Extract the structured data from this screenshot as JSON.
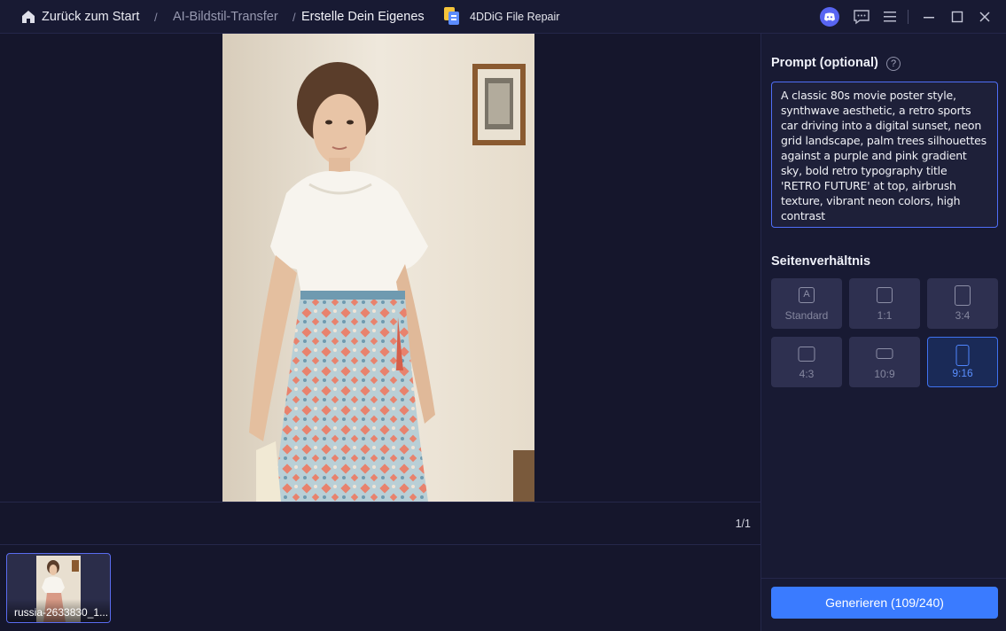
{
  "header": {
    "breadcrumb_home": "Zurück zum Start",
    "separator": "/",
    "breadcrumb_mid": "AI-Bildstil-Transfer",
    "breadcrumb_current": "Erstelle Dein Eigenes",
    "app_name": "4DDiG File Repair",
    "icons": [
      "home-icon",
      "discord-icon",
      "feedback-icon",
      "menu-icon",
      "minimize-icon",
      "maximize-icon",
      "close-icon"
    ]
  },
  "preview": {
    "pager": "1/1"
  },
  "thumbnails": [
    {
      "label": "russia-2633830_1...",
      "selected": true
    }
  ],
  "panel": {
    "prompt_title": "Prompt (optional)",
    "help_symbol": "?",
    "prompt_text": "A classic 80s movie poster style, synthwave aesthetic, a retro sports car driving into a digital sunset, neon grid landscape, palm trees silhouettes against a purple and pink gradient sky, bold retro typography title 'RETRO FUTURE' at top, airbrush texture, vibrant neon colors, high contrast",
    "ratio_title": "Seitenverhältnis",
    "ratios": [
      {
        "label": "Standard",
        "icon": "auto-ratio-icon"
      },
      {
        "label": "1:1",
        "icon": "square-ratio-icon"
      },
      {
        "label": "3:4",
        "icon": "portrait-ratio-icon"
      },
      {
        "label": "4:3",
        "icon": "landscape-ratio-icon"
      },
      {
        "label": "10:9",
        "icon": "wide-ratio-icon"
      },
      {
        "label": "9:16",
        "icon": "tall-ratio-icon",
        "selected": true
      }
    ],
    "generate_label": "Generieren (109/240)"
  },
  "colors": {
    "background": "#15162c",
    "panel": "#181a33",
    "accent": "#3a7bff",
    "selected_border": "#4f6ef7"
  }
}
